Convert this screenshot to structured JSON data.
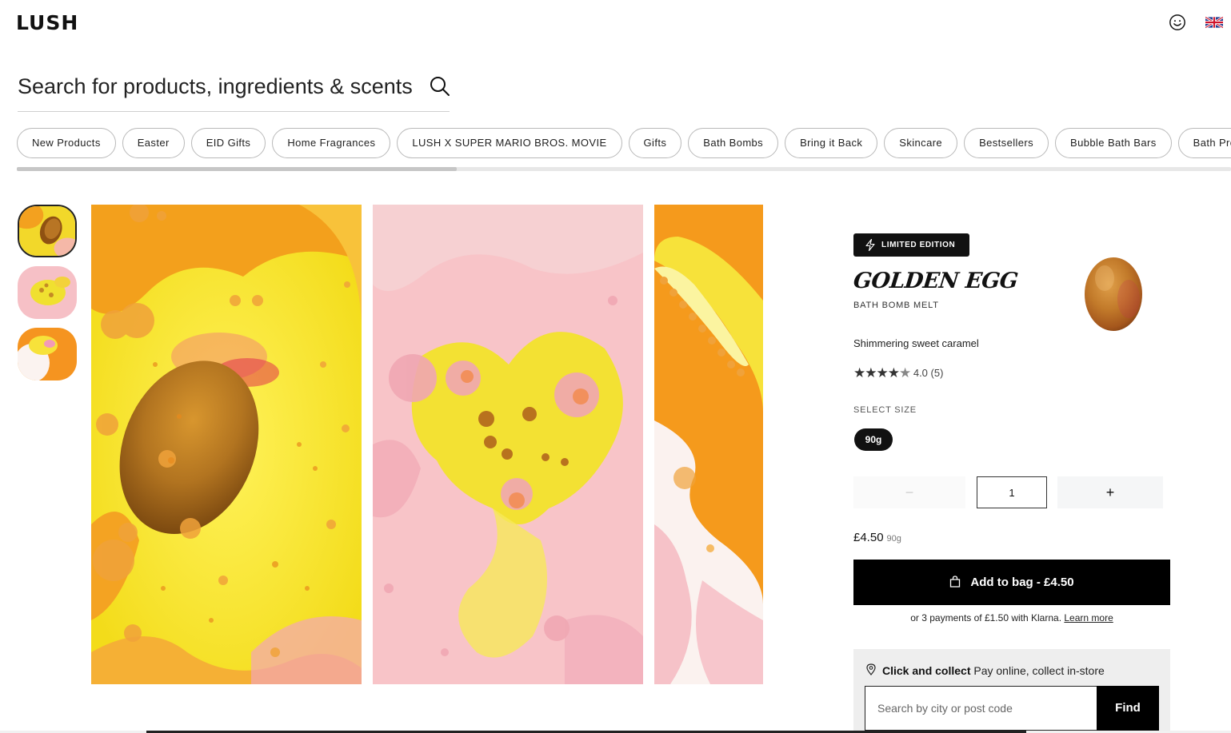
{
  "header": {
    "logo": "LUSH",
    "account_icon": "smiley-face-icon",
    "locale_icon": "uk-flag-icon"
  },
  "search": {
    "placeholder": "Search for products, ingredients & scents",
    "icon": "search-icon"
  },
  "nav_chips": [
    "New Products",
    "Easter",
    "EID Gifts",
    "Home Fragrances",
    "LUSH X SUPER MARIO BROS. MOVIE",
    "Gifts",
    "Bath Bombs",
    "Bring it Back",
    "Skincare",
    "Bestsellers",
    "Bubble Bath Bars",
    "Bath Products"
  ],
  "gallery": {
    "thumbnails": [
      "golden-egg-in-foam",
      "yellow-pink-foam",
      "orange-pink-foam"
    ],
    "active_thumbnail": 0,
    "images": [
      "golden-egg-in-foam",
      "yellow-pink-foam",
      "orange-pink-foam"
    ]
  },
  "product": {
    "badge": "LIMITED EDITION",
    "badge_icon": "lightning-bolt-icon",
    "name": "GOLDEN EGG",
    "type": "BATH BOMB MELT",
    "tagline": "Shimmering sweet caramel",
    "rating": {
      "stars": 4,
      "max_stars": 5,
      "text": "4.0 (5)"
    },
    "size_label": "SELECT SIZE",
    "sizes": [
      "90g"
    ],
    "selected_size": "90g",
    "quantity": "1",
    "qty_minus": "−",
    "qty_plus": "+",
    "price": "£4.50",
    "price_unit": "90g",
    "add_button": "Add to bag - £4.50",
    "klarna_text": "or 3 payments of £1.50 with Klarna.",
    "klarna_link": "Learn more",
    "collect": {
      "title_bold": "Click and collect",
      "title_rest": "Pay online, collect in-store",
      "input_placeholder": "Search by city or post code",
      "find_button": "Find"
    }
  },
  "colors": {
    "brand_black": "#000000",
    "orange": "#f39a1e",
    "yellow": "#f2e21c",
    "pink": "#f6b8c0",
    "gold": "#b8761c"
  }
}
